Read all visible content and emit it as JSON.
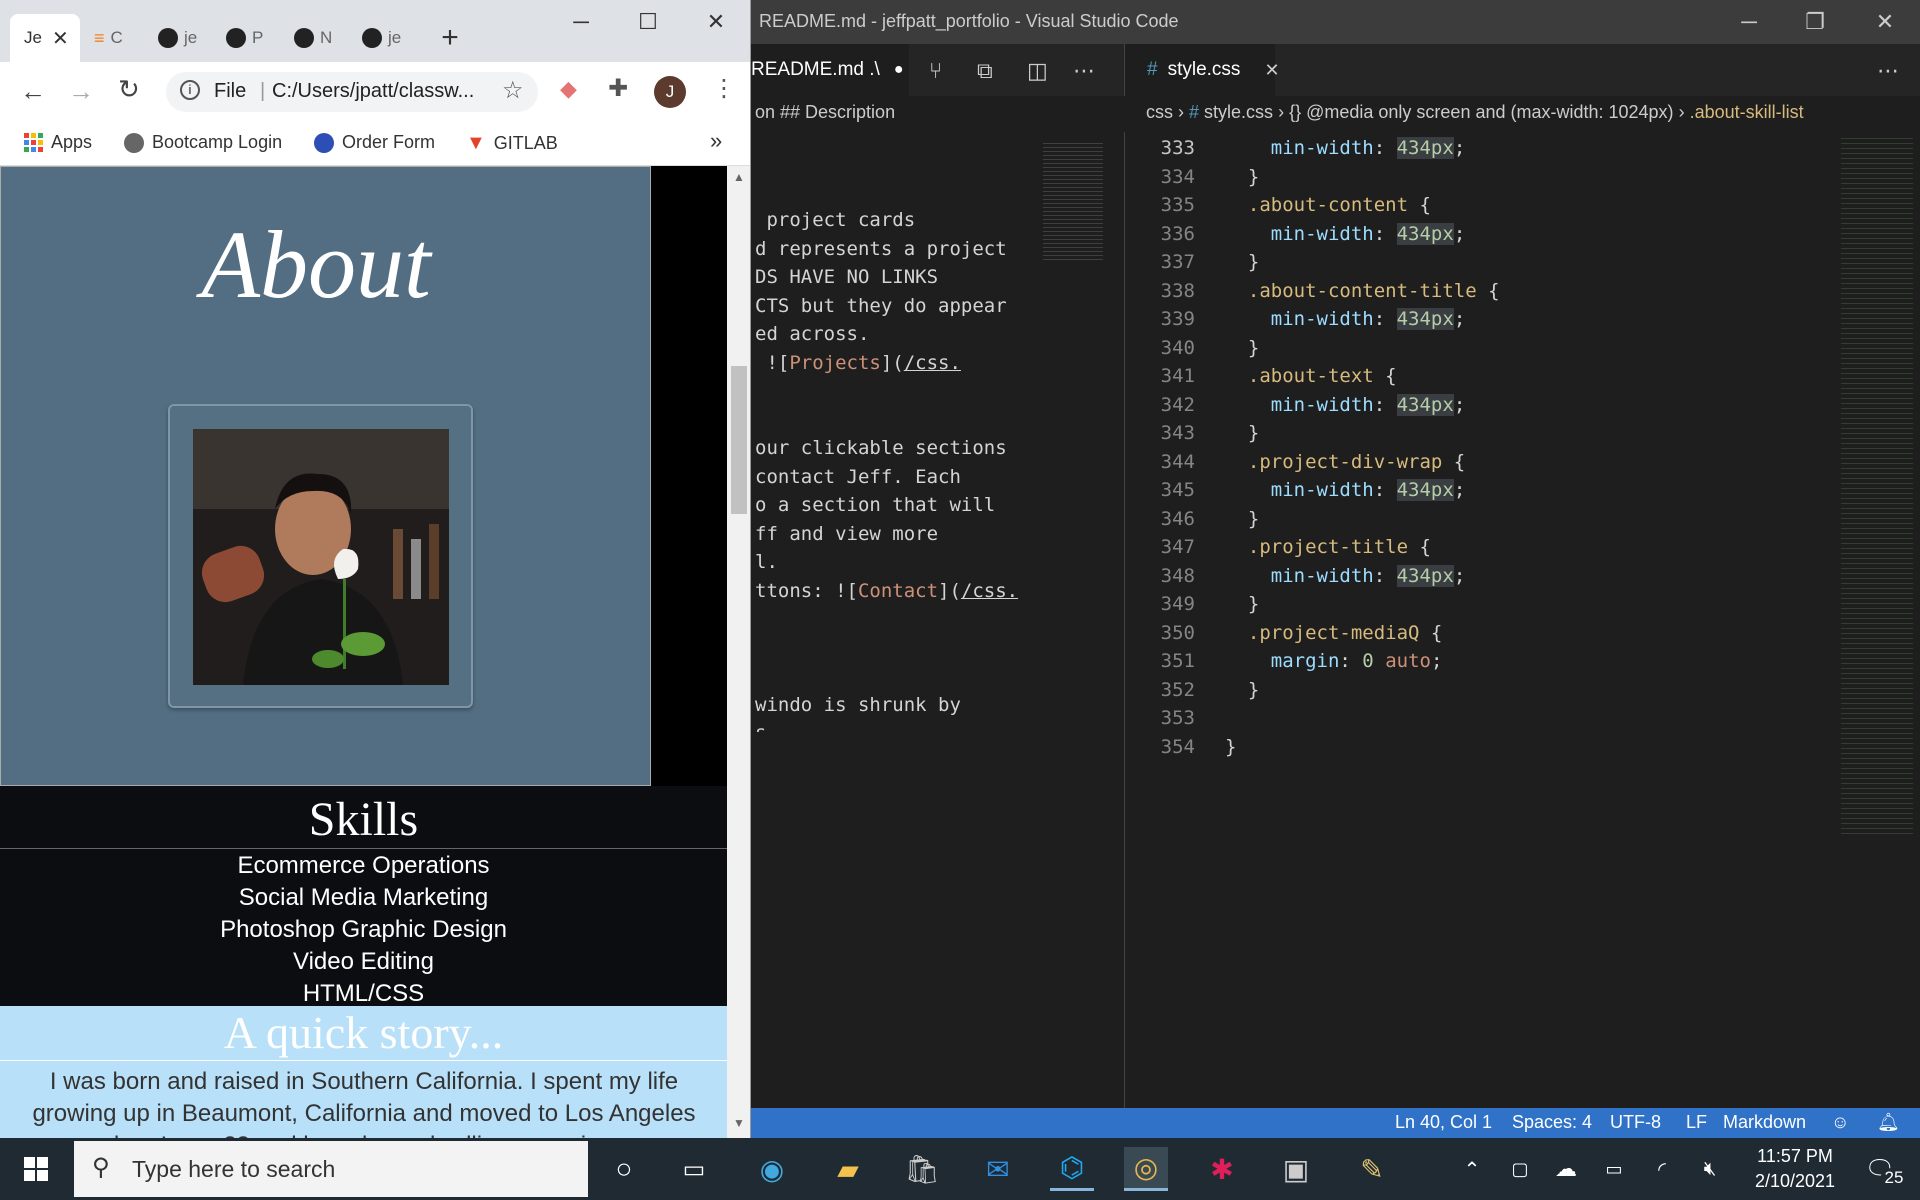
{
  "chrome": {
    "tabs": [
      {
        "label": "Je",
        "active": true
      },
      {
        "label": "C"
      },
      {
        "label": "je"
      },
      {
        "label": "P"
      },
      {
        "label": "N"
      },
      {
        "label": "je"
      }
    ],
    "new_tab_label": "+",
    "address": "C:/Users/jpatt/classw...",
    "address_scheme": "File",
    "profile_initial": "J",
    "bookmarks": [
      "Apps",
      "Bootcamp Login",
      "Order Form",
      "GITLAB"
    ],
    "bookmarks_more": "»"
  },
  "portfolio": {
    "about_title": "About",
    "skills_title": "Skills",
    "skills": [
      "Ecommerce Operations",
      "Social Media Marketing",
      "Photoshop Graphic Design",
      "Video Editing",
      "HTML/CSS"
    ],
    "story_title": "A quick story...",
    "story_text": "I was born and raised in Southern California. I spent my life growing up in Beaumont, California and moved to Los Angeles when I was 23 and have been dwelling ever since."
  },
  "vscode": {
    "window_title": "README.md - jeffpatt_portfolio - Visual Studio Code",
    "left_tab": "README.md .\\",
    "right_tab": "style.css",
    "left_breadcrumb": "on  ## Description",
    "right_breadcrumb": [
      "css",
      "#",
      "style.css",
      "{} @media only screen and (max-width: 1024px)",
      ".about-skill-list"
    ],
    "md_lines": [
      " project cards",
      "d represents a project",
      "DS HAVE NO LINKS",
      "CTS but they do appear",
      "ed across.",
      " ![Projects](/css.",
      "",
      "",
      "our clickable sections",
      "contact Jeff. Each",
      "o a section that will",
      "ff and view more",
      "l.",
      "ttons: ![Contact](/css.",
      "",
      "",
      "",
      "windo is shrunk by",
      "s."
    ],
    "code_lines": [
      {
        "n": "333",
        "text": "    min-width: 434px;"
      },
      {
        "n": "334",
        "text": "  }"
      },
      {
        "n": "335",
        "text": "  .about-content {"
      },
      {
        "n": "336",
        "text": "    min-width: 434px;"
      },
      {
        "n": "337",
        "text": "  }"
      },
      {
        "n": "338",
        "text": "  .about-content-title {"
      },
      {
        "n": "339",
        "text": "    min-width: 434px;"
      },
      {
        "n": "340",
        "text": "  }"
      },
      {
        "n": "341",
        "text": "  .about-text {"
      },
      {
        "n": "342",
        "text": "    min-width: 434px;"
      },
      {
        "n": "343",
        "text": "  }"
      },
      {
        "n": "344",
        "text": "  .project-div-wrap {"
      },
      {
        "n": "345",
        "text": "    min-width: 434px;"
      },
      {
        "n": "346",
        "text": "  }"
      },
      {
        "n": "347",
        "text": "  .project-title {"
      },
      {
        "n": "348",
        "text": "    min-width: 434px;"
      },
      {
        "n": "349",
        "text": "  }"
      },
      {
        "n": "350",
        "text": "  .project-mediaQ {"
      },
      {
        "n": "351",
        "text": "    margin: 0 auto;"
      },
      {
        "n": "352",
        "text": "  }"
      },
      {
        "n": "353",
        "text": ""
      },
      {
        "n": "354",
        "text": "}"
      }
    ],
    "status": {
      "position": "Ln 40, Col 1",
      "spaces": "Spaces: 4",
      "encoding": "UTF-8",
      "eol": "LF",
      "language": "Markdown"
    }
  },
  "taskbar": {
    "search_placeholder": "Type here to search",
    "time": "11:57 PM",
    "date": "2/10/2021",
    "notification_count": "25"
  },
  "colors": {
    "about_bg": "#536e83",
    "skills_bg": "#0b0d10",
    "story_bg": "#b8e0f8",
    "vscode_status": "#2f72c7",
    "taskbar": "#1f2a33"
  }
}
